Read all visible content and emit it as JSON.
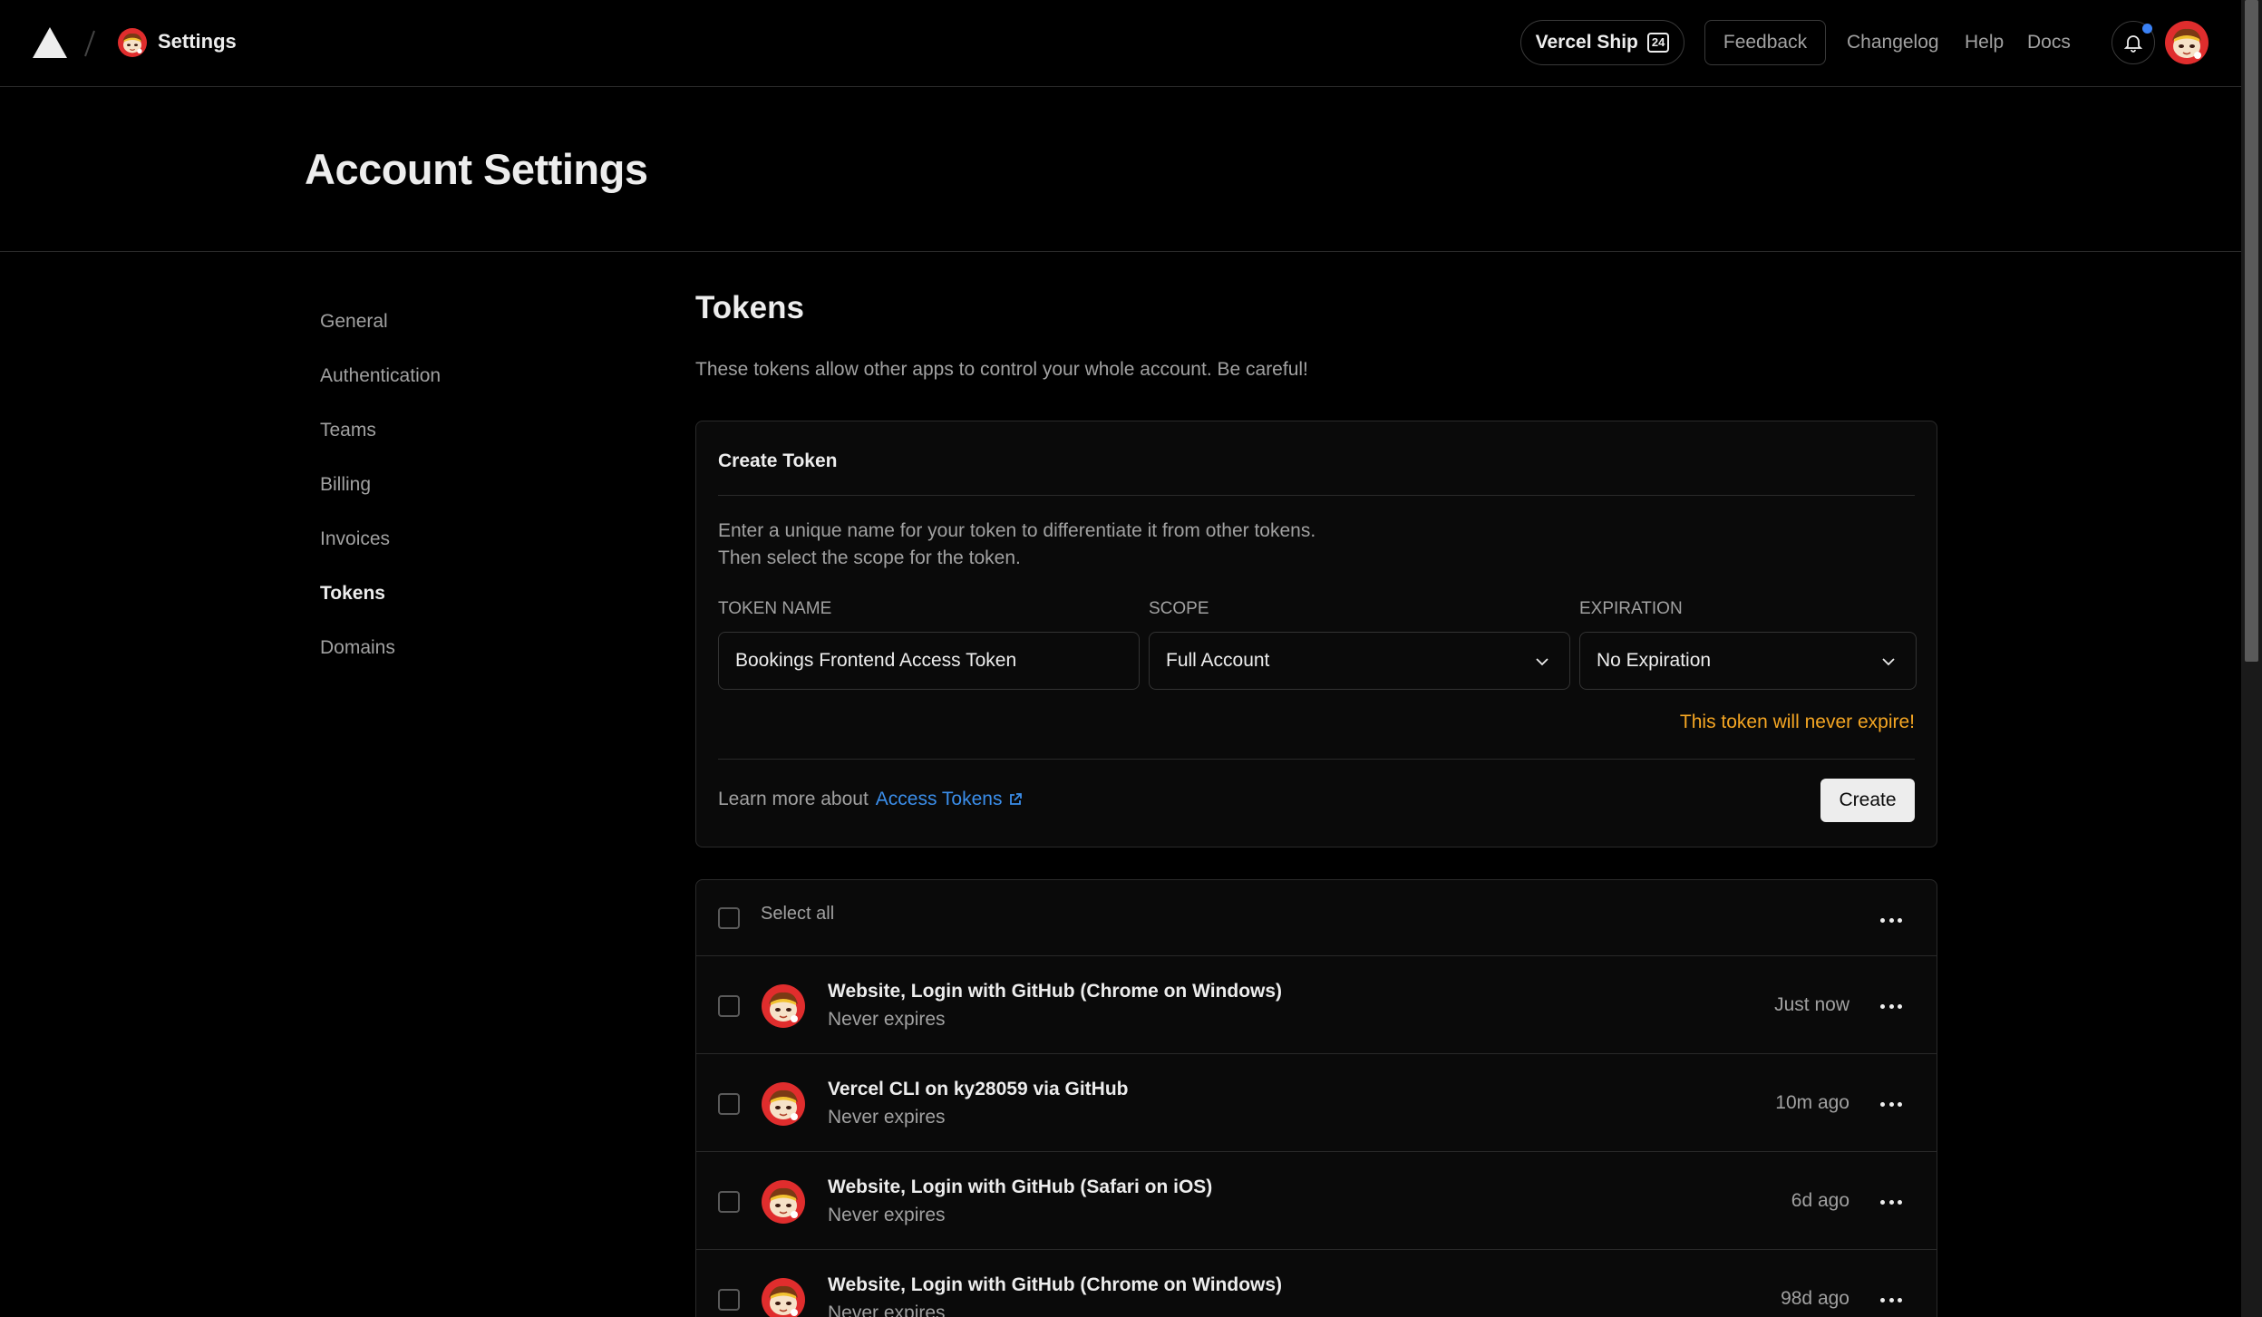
{
  "header": {
    "crumb": "Settings",
    "ship_label": "Vercel Ship",
    "ship_badge": "24",
    "feedback_label": "Feedback",
    "links": [
      "Changelog",
      "Help",
      "Docs"
    ]
  },
  "page": {
    "title": "Account Settings"
  },
  "sidebar": {
    "items": [
      {
        "label": "General",
        "active": false
      },
      {
        "label": "Authentication",
        "active": false
      },
      {
        "label": "Teams",
        "active": false
      },
      {
        "label": "Billing",
        "active": false
      },
      {
        "label": "Invoices",
        "active": false
      },
      {
        "label": "Tokens",
        "active": true
      },
      {
        "label": "Domains",
        "active": false
      }
    ]
  },
  "tokens": {
    "title": "Tokens",
    "description": "These tokens allow other apps to control your whole account. Be careful!"
  },
  "create_card": {
    "title": "Create Token",
    "desc_line1": "Enter a unique name for your token to differentiate it from other tokens.",
    "desc_line2": "Then select the scope for the token.",
    "name_label": "TOKEN NAME",
    "name_value": "Bookings Frontend Access Token",
    "scope_label": "SCOPE",
    "scope_value": "Full Account",
    "expiration_label": "EXPIRATION",
    "expiration_value": "No Expiration",
    "warning": "This token will never expire!",
    "learn_prefix": "Learn more about",
    "learn_link": "Access Tokens",
    "create_label": "Create",
    "warning_color": "#f5a623",
    "link_color": "#3b8eea"
  },
  "token_list": {
    "select_all_label": "Select all",
    "rows": [
      {
        "name": "Website, Login with GitHub (Chrome on Windows)",
        "expires": "Never expires",
        "time": "Just now"
      },
      {
        "name": "Vercel CLI on ky28059 via GitHub",
        "expires": "Never expires",
        "time": "10m ago"
      },
      {
        "name": "Website, Login with GitHub (Safari on iOS)",
        "expires": "Never expires",
        "time": "6d ago"
      },
      {
        "name": "Website, Login with GitHub (Chrome on Windows)",
        "expires": "Never expires",
        "time": "98d ago"
      }
    ]
  }
}
